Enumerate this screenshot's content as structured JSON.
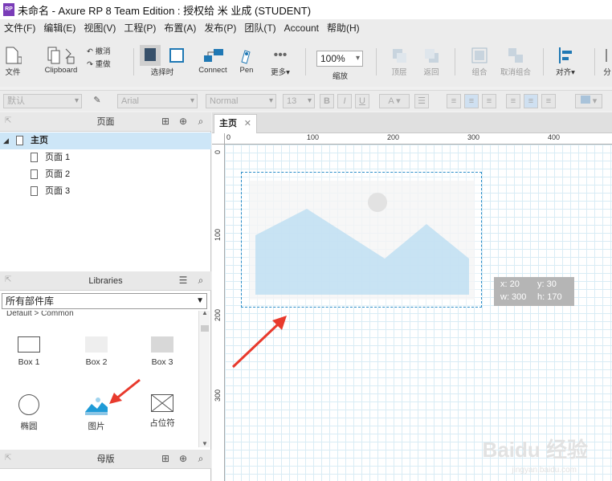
{
  "window": {
    "app_icon_text": "RP",
    "title": "未命名 - Axure RP 8 Team Edition : 授权给 米 业成 (STUDENT)"
  },
  "menubar": {
    "items": [
      "文件(F)",
      "编辑(E)",
      "视图(V)",
      "工程(P)",
      "布置(A)",
      "发布(P)",
      "团队(T)",
      "Account",
      "帮助(H)"
    ]
  },
  "toolbar": {
    "file_label": "文件",
    "clipboard_label": "Clipboard",
    "undo_label": "撤消",
    "redo_label": "重做",
    "select_label": "选择时",
    "connect_label": "Connect",
    "pen_label": "Pen",
    "more_label": "更多▾",
    "zoom_value": "100%",
    "zoom_label": "缩放",
    "top_label": "顶层",
    "back_label": "返回",
    "group_label": "组合",
    "ungroup_label": "取消组合",
    "align_label": "对齐▾",
    "dist_label": "分"
  },
  "formatbar": {
    "style_value": "默认",
    "font_value": "Arial",
    "weight_value": "Normal",
    "size_value": "13",
    "bold": "B",
    "italic": "I",
    "underline": "U",
    "font_color": "A"
  },
  "pages_panel": {
    "title": "页面",
    "home": "主页",
    "pages": [
      "页面 1",
      "页面 2",
      "页面 3"
    ]
  },
  "libraries_panel": {
    "title": "Libraries",
    "selected_library": "所有部件库",
    "section": "Default > Common",
    "items": [
      {
        "label": "Box 1",
        "icon": "box1-icon"
      },
      {
        "label": "Box 2",
        "icon": "box2-icon"
      },
      {
        "label": "Box 3",
        "icon": "box3-icon"
      },
      {
        "label": "椭圆",
        "icon": "ellipse-icon"
      },
      {
        "label": "图片",
        "icon": "image-icon"
      },
      {
        "label": "占位符",
        "icon": "placeholder-icon"
      }
    ]
  },
  "masters_panel": {
    "title": "母版"
  },
  "canvas": {
    "tab_label": "主页",
    "tab_close": "✕",
    "hruler_ticks": [
      "0",
      "100",
      "200",
      "300",
      "400"
    ],
    "vruler_ticks": [
      "0",
      "100",
      "200",
      "300"
    ],
    "tooltip": {
      "x": "x: 20",
      "y": "y: 30",
      "w": "w: 300",
      "h": "h: 170"
    }
  },
  "watermark": {
    "text": "Baidu 经验",
    "sub": "jingyan.baidu.com"
  },
  "colors": {
    "accent_blue": "#1f9bd7",
    "image_fill": "#c5e3f5",
    "selection": "#2a8dc8",
    "arrow_red": "#e83a2d"
  }
}
